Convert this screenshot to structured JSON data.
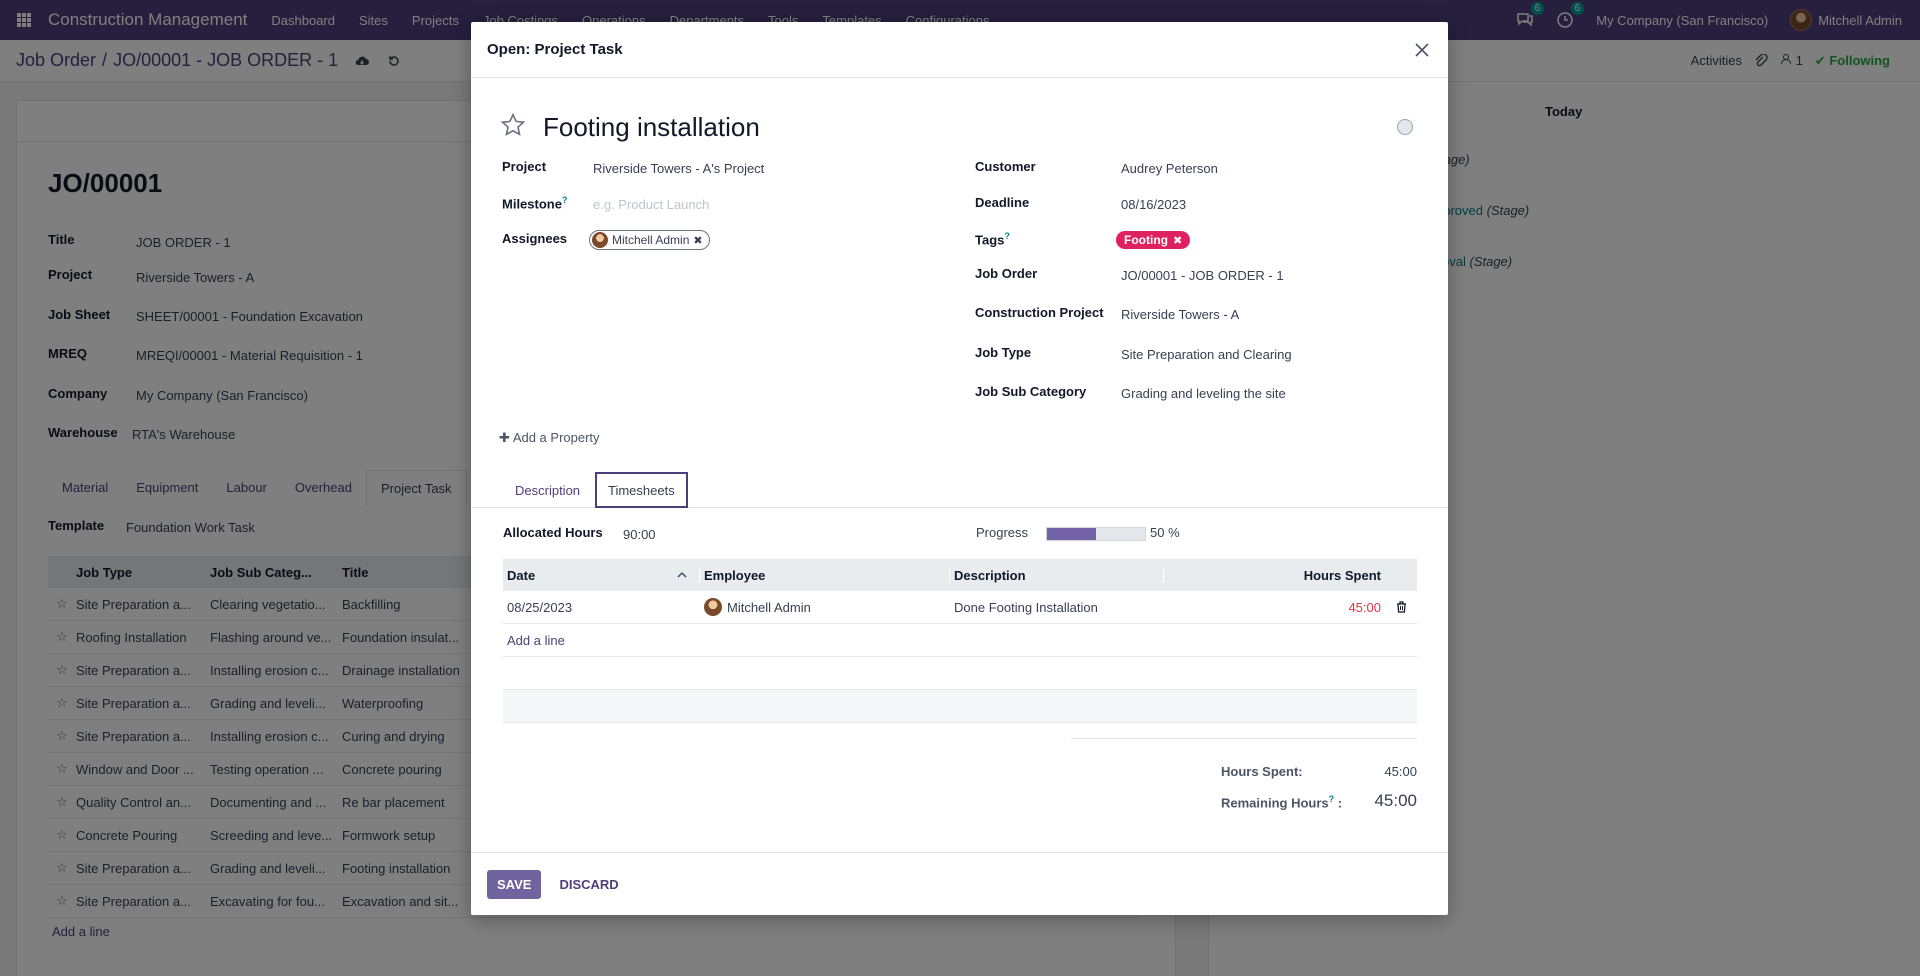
{
  "navbar": {
    "brand": "Construction Management",
    "menu": [
      "Dashboard",
      "Sites",
      "Projects",
      "Job Costings",
      "Operations",
      "Departments",
      "Tools",
      "Templates",
      "Configurations"
    ],
    "messages_badge": "6",
    "activities_badge": "6",
    "company": "My Company (San Francisco)",
    "user": "Mitchell Admin"
  },
  "control_panel": {
    "breadcrumb_root": "Job Order",
    "breadcrumb_sep": "/",
    "breadcrumb_current": "JO/00001 - JOB ORDER - 1",
    "activities": "Activities",
    "followers_count": "1",
    "following": "Following"
  },
  "background_form": {
    "title": "JO/00001",
    "fields": [
      {
        "label": "Title",
        "value": "JOB ORDER - 1"
      },
      {
        "label": "Project",
        "value": "Riverside Towers - A"
      },
      {
        "label": "Job Sheet",
        "value": "SHEET/00001 - Foundation Excavation"
      },
      {
        "label": "MREQ",
        "value": "MREQI/00001 - Material Requisition - 1"
      },
      {
        "label": "Company",
        "value": "My Company (San Francisco)"
      },
      {
        "label": "Warehouse",
        "value": "RTA's Warehouse"
      }
    ],
    "tabs": [
      "Material",
      "Equipment",
      "Labour",
      "Overhead",
      "Project Task"
    ],
    "template_label": "Template",
    "template_value": "Foundation Work Task",
    "table_headers": [
      "Job Type",
      "Job Sub Categ...",
      "Title"
    ],
    "rows": [
      {
        "type": "Site Preparation a...",
        "sub": "Clearing vegetatio...",
        "title": "Backfilling"
      },
      {
        "type": "Roofing Installation",
        "sub": "Flashing around ve...",
        "title": "Foundation insulat..."
      },
      {
        "type": "Site Preparation a...",
        "sub": "Installing erosion c...",
        "title": "Drainage installation"
      },
      {
        "type": "Site Preparation a...",
        "sub": "Grading and leveli...",
        "title": "Waterproofing"
      },
      {
        "type": "Site Preparation a...",
        "sub": "Installing erosion c...",
        "title": "Curing and drying"
      },
      {
        "type": "Window and Door ...",
        "sub": "Testing operation ...",
        "title": "Concrete pouring"
      },
      {
        "type": "Quality Control an...",
        "sub": "Documenting and ...",
        "title": "Re bar placement"
      },
      {
        "type": "Concrete Pouring",
        "sub": "Screeding and leve...",
        "title": "Formwork setup"
      },
      {
        "type": "Site Preparation a...",
        "sub": "Grading and leveli...",
        "title": "Footing installation"
      },
      {
        "type": "Site Preparation a...",
        "sub": "Excavating for fou...",
        "title": "Excavation and sit..."
      }
    ],
    "add_line": "Add a line"
  },
  "chatter": {
    "today": "Today",
    "line1": "tage)",
    "line2_link": "pproved",
    "line2": "(Stage)",
    "line3_link": "oval",
    "line3": "(Stage)"
  },
  "modal": {
    "title": "Open: Project Task",
    "task_name": "Footing installation",
    "left_fields": {
      "project_label": "Project",
      "project_value": "Riverside Towers - A's Project",
      "milestone_label": "Milestone",
      "milestone_placeholder": "e.g. Product Launch",
      "assignees_label": "Assignees",
      "assignee": "Mitchell Admin"
    },
    "right_fields": {
      "customer_label": "Customer",
      "customer_value": "Audrey Peterson",
      "deadline_label": "Deadline",
      "deadline_value": "08/16/2023",
      "tags_label": "Tags",
      "tag": "Footing",
      "job_order_label": "Job Order",
      "job_order_value": "JO/00001 - JOB ORDER - 1",
      "construction_project_label": "Construction Project",
      "construction_project_value": "Riverside Towers - A",
      "job_type_label": "Job Type",
      "job_type_value": "Site Preparation and Clearing",
      "job_sub_category_label": "Job Sub Category",
      "job_sub_category_value": "Grading and leveling the site"
    },
    "add_property": "Add a Property",
    "tabs": [
      "Description",
      "Timesheets"
    ],
    "allocated_hours_label": "Allocated Hours",
    "allocated_hours_value": "90:00",
    "progress_label": "Progress",
    "progress_fraction": 0.5,
    "progress_text": "50 %",
    "timesheet_headers": {
      "date": "Date",
      "employee": "Employee",
      "description": "Description",
      "hours": "Hours Spent"
    },
    "timesheet_rows": [
      {
        "date": "08/25/2023",
        "employee": "Mitchell Admin",
        "description": "Done Footing Installation",
        "hours": "45:00"
      }
    ],
    "add_line": "Add a line",
    "hours_spent_label": "Hours Spent:",
    "hours_spent_value": "45:00",
    "remaining_hours_label": "Remaining Hours",
    "remaining_hours_colon": ":",
    "remaining_hours_value": "45:00",
    "save": "SAVE",
    "discard": "DISCARD"
  },
  "colors": {
    "navbar": "#4c3f7a",
    "primary": "#71639e",
    "tag": "#e0215f",
    "overtime": "#dc3545",
    "following": "#28a745"
  }
}
